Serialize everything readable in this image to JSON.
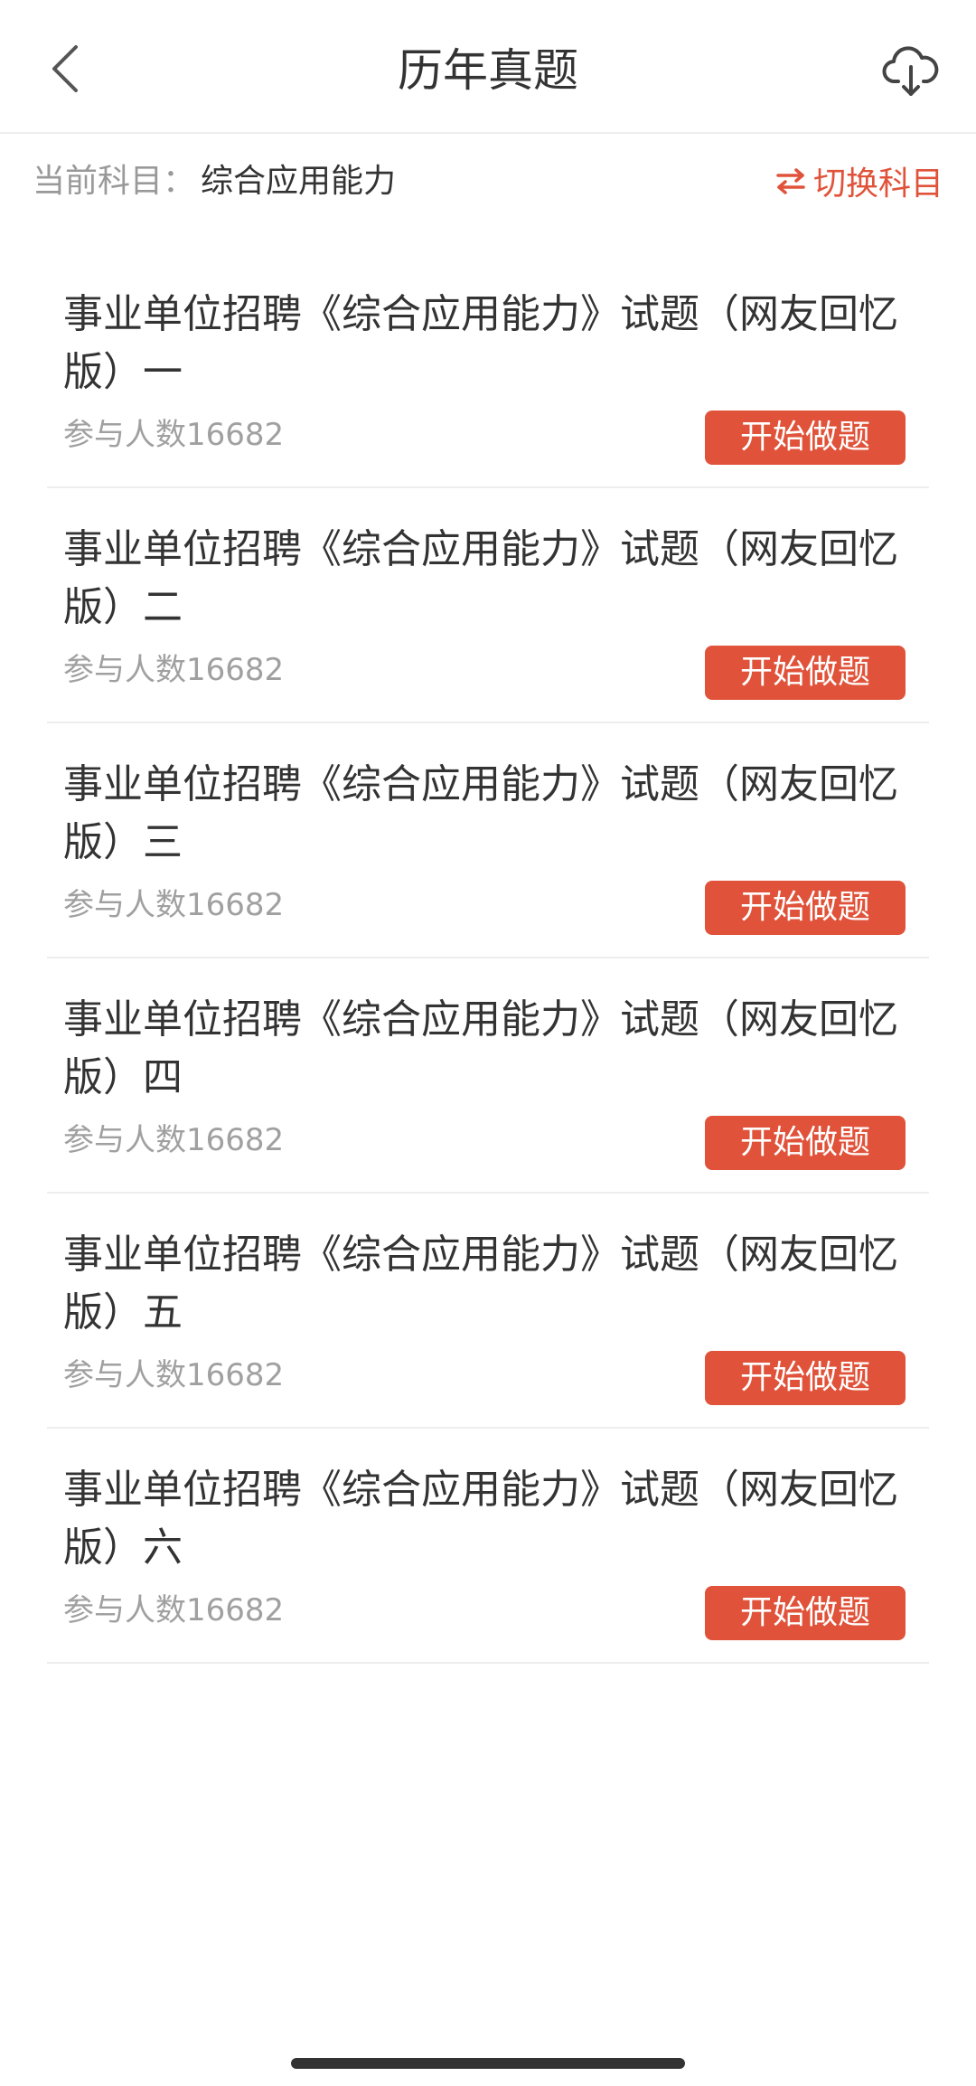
{
  "header": {
    "title": "历年真题"
  },
  "subject": {
    "label": "当前科目：",
    "value": "综合应用能力",
    "switch_label": "切换科目"
  },
  "accent_color": "#e0533a",
  "items": [
    {
      "title": "事业单位招聘《综合应用能力》试题（网友回忆版）一",
      "count_prefix": "参与人数",
      "count": "16682",
      "button_label": "开始做题"
    },
    {
      "title": "事业单位招聘《综合应用能力》试题（网友回忆版）二",
      "count_prefix": "参与人数",
      "count": "16682",
      "button_label": "开始做题"
    },
    {
      "title": "事业单位招聘《综合应用能力》试题（网友回忆版）三",
      "count_prefix": "参与人数",
      "count": "16682",
      "button_label": "开始做题"
    },
    {
      "title": "事业单位招聘《综合应用能力》试题（网友回忆版）四",
      "count_prefix": "参与人数",
      "count": "16682",
      "button_label": "开始做题"
    },
    {
      "title": "事业单位招聘《综合应用能力》试题（网友回忆版）五",
      "count_prefix": "参与人数",
      "count": "16682",
      "button_label": "开始做题"
    },
    {
      "title": "事业单位招聘《综合应用能力》试题（网友回忆版）六",
      "count_prefix": "参与人数",
      "count": "16682",
      "button_label": "开始做题"
    }
  ]
}
